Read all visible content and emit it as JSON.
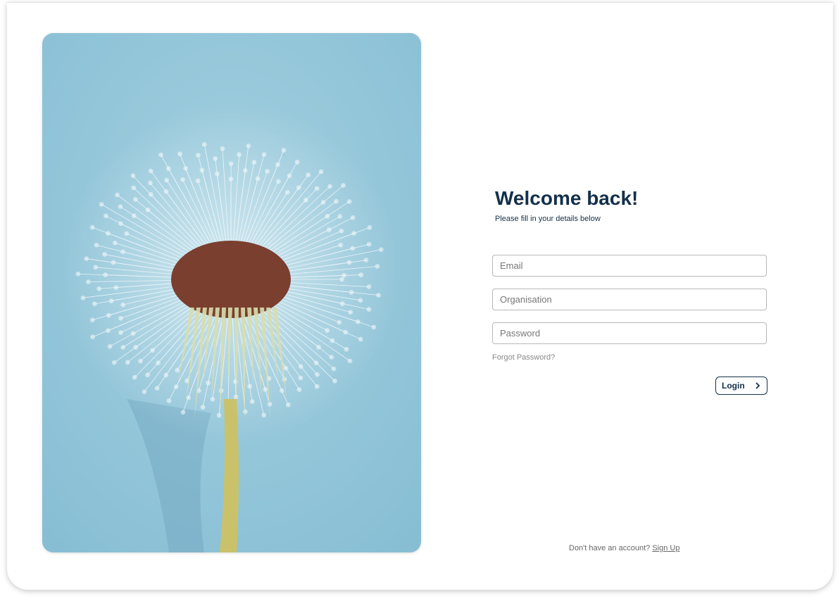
{
  "colors": {
    "primary": "#14304a",
    "photo_bg": "#8fc4d8"
  },
  "hero_image": {
    "description_icon": "dandelion-image"
  },
  "form": {
    "title": "Welcome back!",
    "subtitle": "Please fill in your details below",
    "email_placeholder": "Email",
    "organisation_placeholder": "Organisation",
    "password_placeholder": "Password",
    "forgot_password": "Forgot Password?",
    "login_label": "Login",
    "login_icon": "chevron-right-icon"
  },
  "footer": {
    "prompt": "Don't have an account?",
    "signup_link": "Sign Up"
  }
}
